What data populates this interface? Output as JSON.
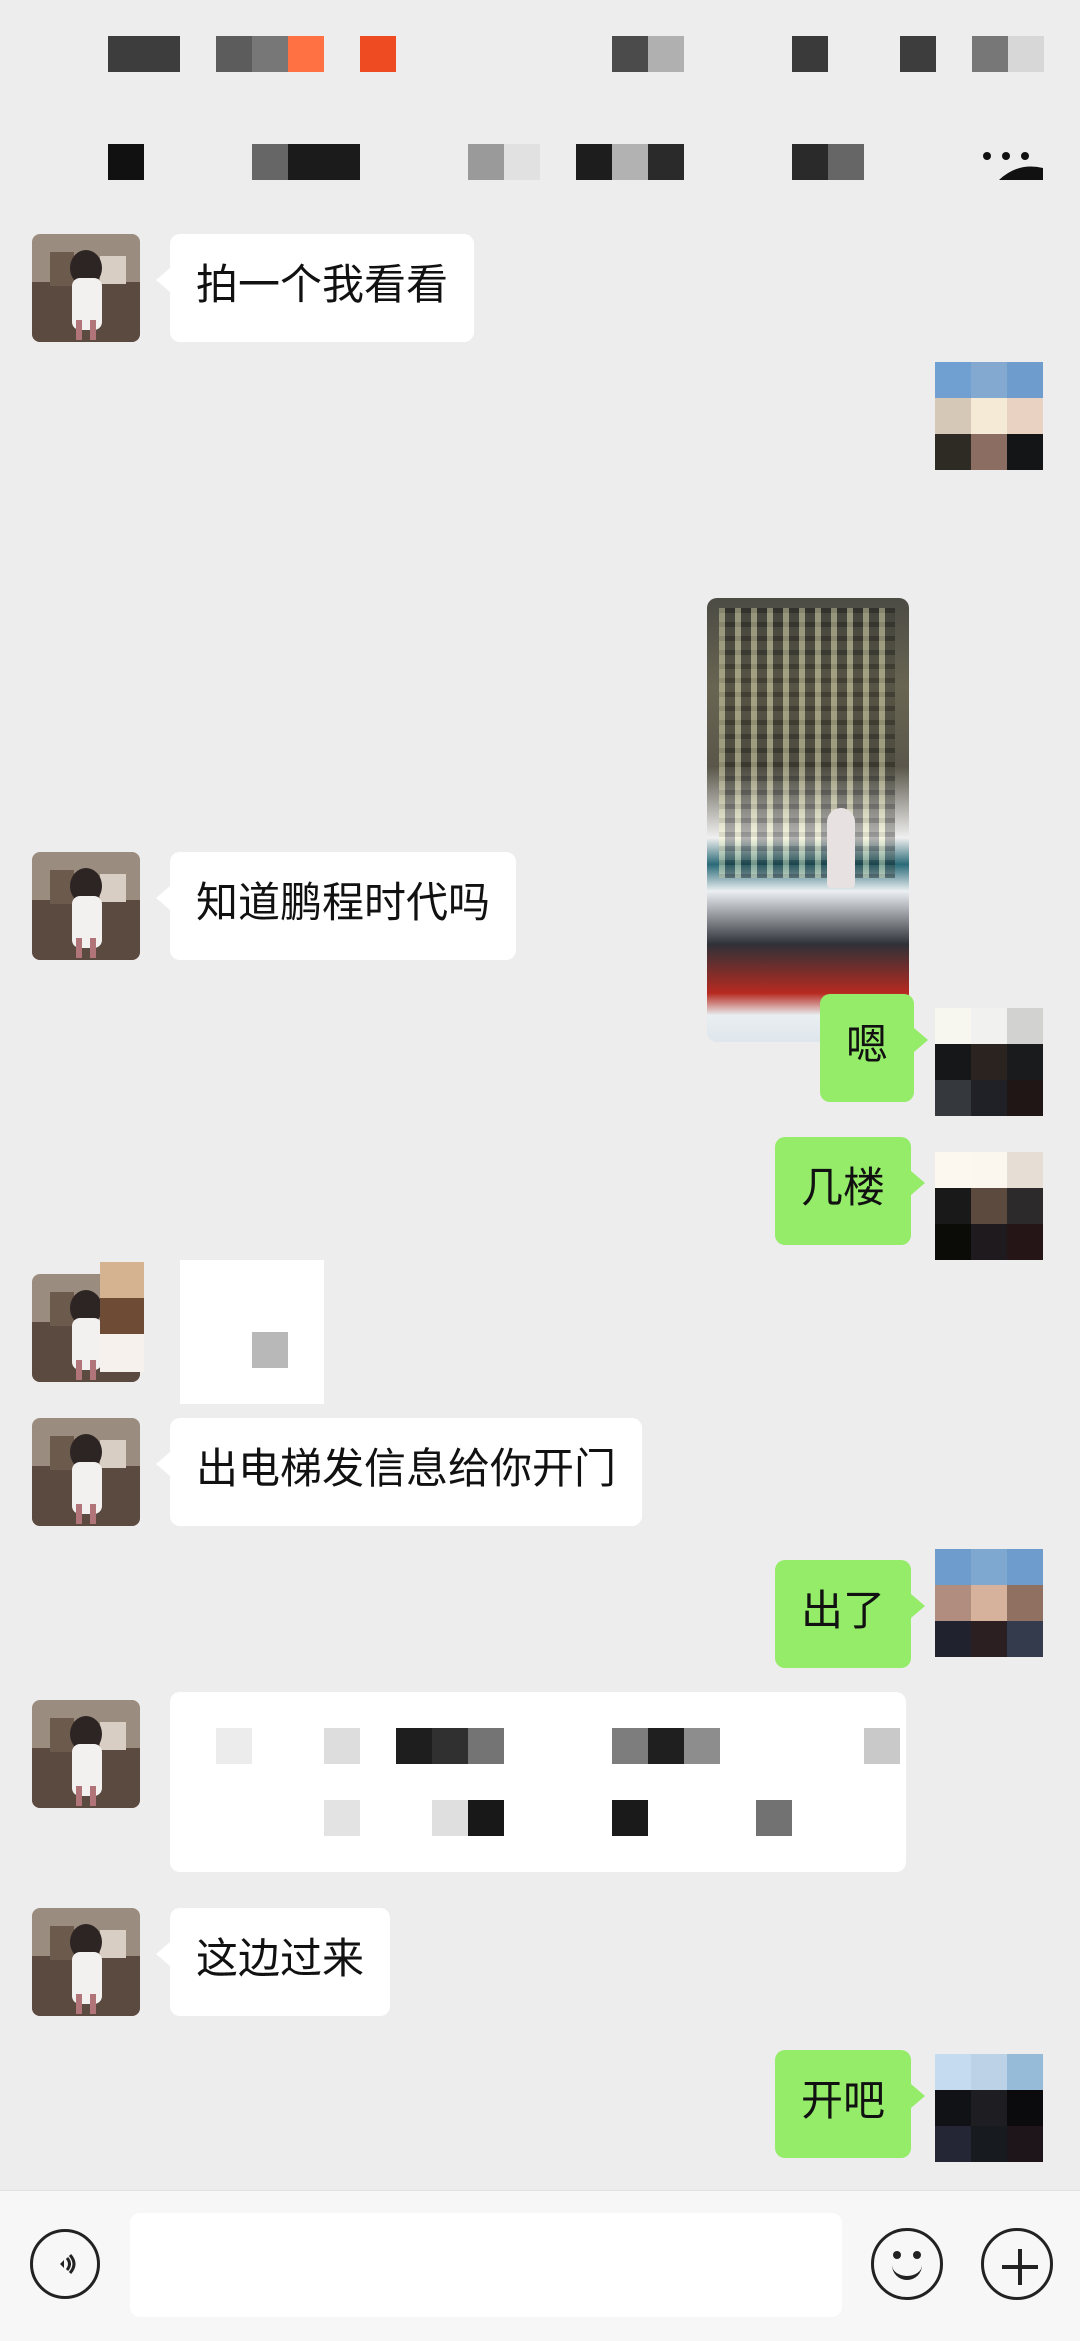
{
  "header": {
    "mosaic_blocks": [
      {
        "row": 0,
        "colors": [
          "#3d3d3d",
          "#3d3d3d",
          "#3d3d3d"
        ]
      },
      {
        "row": 0,
        "colors": [
          "#5c5c5c",
          "#777777",
          "#ff7043"
        ]
      },
      {
        "row": 0,
        "colors": [
          "#ee4b22"
        ]
      },
      {
        "row": 0,
        "colors": [
          "#4b4b4b",
          "#b0b0b0"
        ]
      },
      {
        "row": 0,
        "colors": [
          "#3a3a3a"
        ]
      },
      {
        "row": 0,
        "colors": [
          "#3d3d3d"
        ]
      },
      {
        "row": 0,
        "colors": [
          "#777777",
          "#d7d7d7"
        ]
      },
      {
        "row": 1,
        "colors": [
          "#111111"
        ]
      },
      {
        "row": 1,
        "colors": [
          "#666666",
          "#1b1b1b",
          "#1b1b1b"
        ]
      },
      {
        "row": 1,
        "colors": [
          "#9a9a9a",
          "#e1e1e1"
        ]
      },
      {
        "row": 1,
        "colors": [
          "#1d1d1d",
          "#b2b2b2",
          "#2a2a2a"
        ]
      },
      {
        "row": 1,
        "colors": [
          "#2a2a2a",
          "#666666"
        ]
      }
    ],
    "more_icon": "more-icon"
  },
  "messages": [
    {
      "side": "left",
      "text": "拍一个我看看"
    },
    {
      "side": "right",
      "type": "image",
      "caption": ""
    },
    {
      "side": "left",
      "text": "知道鹏程时代吗"
    },
    {
      "side": "right",
      "text": "嗯"
    },
    {
      "side": "right",
      "text": "几楼"
    },
    {
      "side": "left",
      "type": "mosaic"
    },
    {
      "side": "left",
      "text": "出电梯发信息给你开门"
    },
    {
      "side": "right",
      "text": "出了"
    },
    {
      "side": "left",
      "type": "mosaic"
    },
    {
      "side": "left",
      "text": "这边过来"
    },
    {
      "side": "right",
      "text": "开吧"
    }
  ],
  "bottom_bar": {
    "voice_icon": "voice-icon",
    "emoji_icon": "emoji-icon",
    "add_icon": "add-icon"
  },
  "colors": {
    "chat_background": "#ededed",
    "green_bubble": "#95ec69",
    "white_bubble": "#ffffff"
  }
}
